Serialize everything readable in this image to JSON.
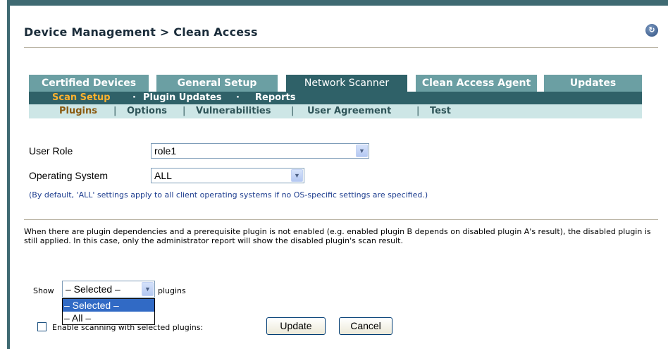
{
  "header": {
    "title": "Device Management > Clean Access"
  },
  "tabs": [
    {
      "label": "Certified Devices",
      "active": false
    },
    {
      "label": "General Setup",
      "active": false
    },
    {
      "label": "Network Scanner",
      "active": true
    },
    {
      "label": "Clean Access Agent",
      "active": false
    },
    {
      "label": "Updates",
      "active": false
    }
  ],
  "subnav": {
    "items": [
      "Scan Setup",
      "Plugin Updates",
      "Reports"
    ],
    "separator": "·",
    "current": "Scan Setup"
  },
  "subsubnav": {
    "items": [
      "Plugins",
      "Options",
      "Vulnerabilities",
      "User Agreement",
      "Test"
    ],
    "separator": "|",
    "current": "Plugins"
  },
  "form": {
    "user_role_label": "User Role",
    "user_role_value": "role1",
    "os_label": "Operating System",
    "os_value": "ALL",
    "os_note": "(By default, 'ALL' settings apply to all client operating systems if no OS-specific settings are specified.)",
    "plugin_note": "When there are plugin dependencies and a prerequisite plugin is not enabled (e.g. enabled plugin B depends on disabled plugin A's result), the disabled plugin is still applied. In this case, only the administrator report will show the disabled plugin's scan result.",
    "show_label": "Show",
    "show_value": "– Selected –",
    "show_suffix": "plugins",
    "show_options": [
      "– Selected –",
      "– All –"
    ],
    "enable_label": "Enable scanning with selected plugins:",
    "update_button": "Update",
    "cancel_button": "Cancel"
  },
  "colors": {
    "tab_active": "#2f6168",
    "tab_inactive": "#6b9fa3",
    "subnav_current": "#ffb22e",
    "note_text": "#1d3d8f"
  }
}
